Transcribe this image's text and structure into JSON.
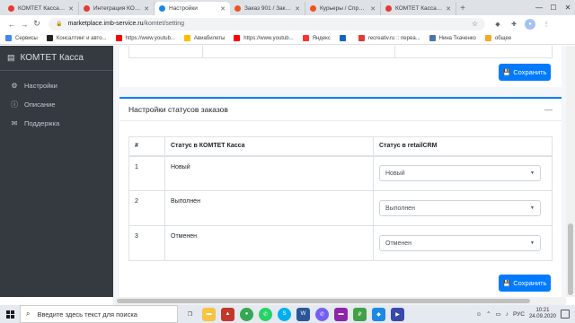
{
  "browser": {
    "tabs": [
      {
        "title": "КОМТЕТ Касса - Ос",
        "color": "#e53935",
        "active": false
      },
      {
        "title": "Интеграция КОМТЕ",
        "color": "#e53935",
        "active": false
      },
      {
        "title": "Настройки",
        "color": "#1e88e5",
        "active": true
      },
      {
        "title": "Заказ 901 / Заказы",
        "color": "#f4511e",
        "active": false
      },
      {
        "title": "Курьеры / Справоч",
        "color": "#f4511e",
        "active": false
      },
      {
        "title": "КОМТЕТ Касса - Ос",
        "color": "#e53935",
        "active": false
      }
    ],
    "new_tab": "+",
    "url_host": "marketplace.imb-service.ru",
    "url_path": "/komtet/setting",
    "bookmarks": [
      {
        "label": "Сервисы",
        "color": "#4285f4"
      },
      {
        "label": "Консалтинг и авто...",
        "color": "#222222"
      },
      {
        "label": "https://www.youtub...",
        "color": "#ff0000"
      },
      {
        "label": "Авиабилеты",
        "color": "#fbbc05"
      },
      {
        "label": "https://www.youtub...",
        "color": "#ff0000"
      },
      {
        "label": "Яндекс",
        "color": "#ff3333"
      },
      {
        "label": "",
        "color": "#1565c0"
      },
      {
        "label": "recreativ.ru :: переа...",
        "color": "#e53935"
      },
      {
        "label": "Нина Ткаченко",
        "color": "#4a76a8"
      },
      {
        "label": "общее",
        "color": "#f9a825"
      }
    ]
  },
  "sidebar": {
    "brand": "КОМТЕТ Касса",
    "items": [
      {
        "label": "Настройки",
        "icon": "gears-icon"
      },
      {
        "label": "Описание",
        "icon": "info-icon"
      },
      {
        "label": "Поддержка",
        "icon": "chat-icon"
      }
    ]
  },
  "top_card": {
    "save_label": "Сохранить"
  },
  "status_card": {
    "title": "Настройки статусов заказов",
    "collapse": "—",
    "columns": [
      "#",
      "Статус в КОМТЕТ Касса",
      "Статус в retailCRM"
    ],
    "rows": [
      {
        "num": "1",
        "komtet": "Новый",
        "crm": "Новый"
      },
      {
        "num": "2",
        "komtet": "Выполнен",
        "crm": "Выполнен"
      },
      {
        "num": "3",
        "komtet": "Отменен",
        "crm": "Отменен"
      }
    ],
    "save_label": "Сохранить"
  },
  "taskbar": {
    "search_placeholder": "Введите здесь текст для поиска",
    "lang": "РУС",
    "time": "10:21",
    "date": "24.09.2020"
  }
}
